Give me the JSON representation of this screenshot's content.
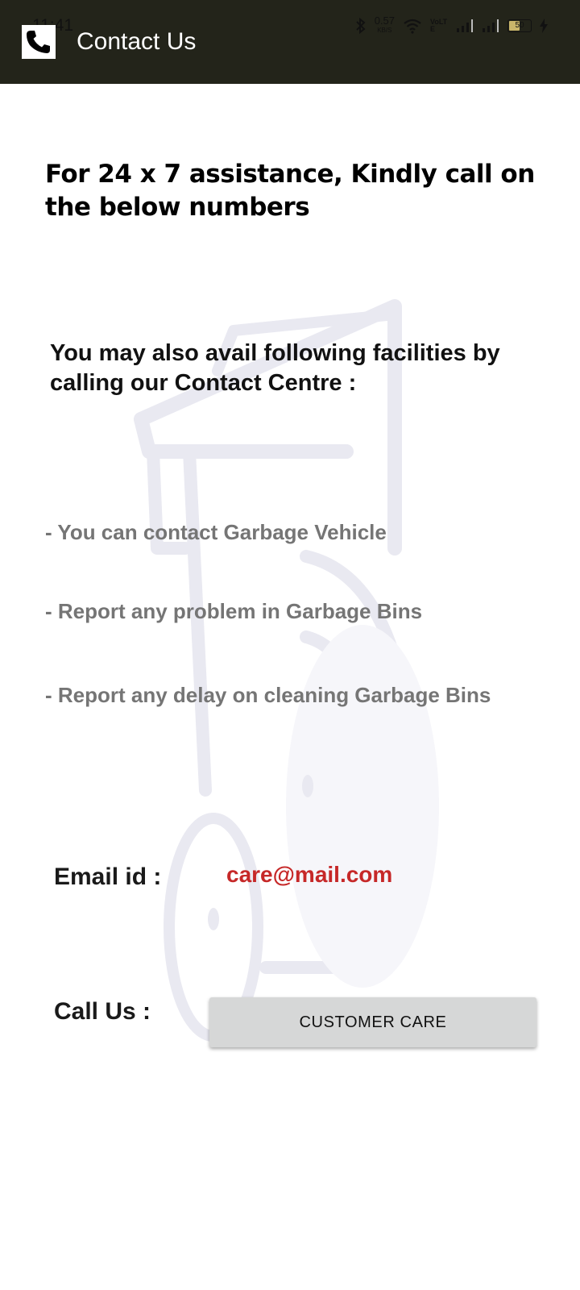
{
  "status_bar": {
    "time": "11:41",
    "network_speed": "0.57",
    "network_unit": "KB/S",
    "volte": "VoLTE",
    "battery": "50"
  },
  "app_bar": {
    "title": "Contact Us",
    "icon": "phone-icon",
    "background": "#23241a"
  },
  "content": {
    "heading": "For 24 x 7 assistance, Kindly call on the below numbers",
    "subheading": "You may also avail following facilities by calling our Contact Centre :",
    "facilities": [
      "- You can contact Garbage Vehicle",
      " - Report any problem in Garbage Bins",
      " - Report any delay on cleaning Garbage Bins"
    ],
    "email_label": "Email id :",
    "email_value": "care@mail.com",
    "call_label": "Call Us :",
    "call_button": "CUSTOMER CARE"
  },
  "colors": {
    "email": "#c62828",
    "button_bg": "#d6d7d7",
    "facility_text": "#757575"
  }
}
